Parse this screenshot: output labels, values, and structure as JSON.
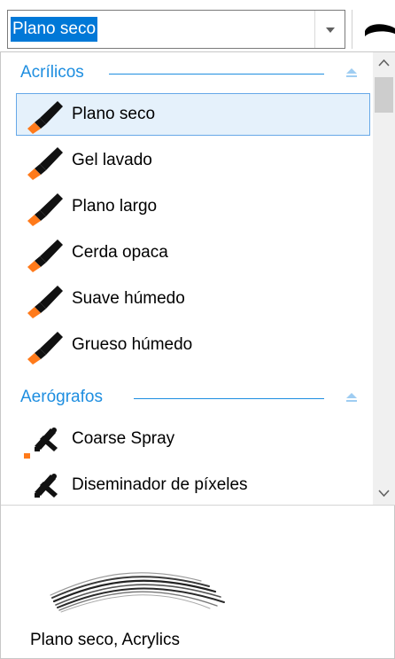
{
  "combo": {
    "selected_value": "Plano seco"
  },
  "groups": [
    {
      "title": "Acrílicos"
    },
    {
      "title": "Aerógrafos"
    }
  ],
  "acrylic_items": [
    {
      "label": "Plano seco",
      "icon": "acrylic-brush-icon"
    },
    {
      "label": "Gel lavado",
      "icon": "acrylic-brush-icon"
    },
    {
      "label": "Plano largo",
      "icon": "acrylic-brush-icon"
    },
    {
      "label": "Cerda opaca",
      "icon": "acrylic-brush-icon"
    },
    {
      "label": "Suave húmedo",
      "icon": "acrylic-brush-icon"
    },
    {
      "label": "Grueso húmedo",
      "icon": "acrylic-brush-icon"
    }
  ],
  "airbrush_items": [
    {
      "label": "Coarse Spray",
      "icon": "airbrush-icon"
    },
    {
      "label": "Diseminador de píxeles",
      "icon": "airbrush-icon"
    }
  ],
  "preview": {
    "description": "Plano seco, Acrylics"
  },
  "colors": {
    "accent": "#1e8ee0",
    "selection_bg": "#e5f1fb",
    "selection_border": "#66a8e8",
    "combo_highlight": "#0078d7",
    "brush_tip": "#ff7a1a"
  }
}
